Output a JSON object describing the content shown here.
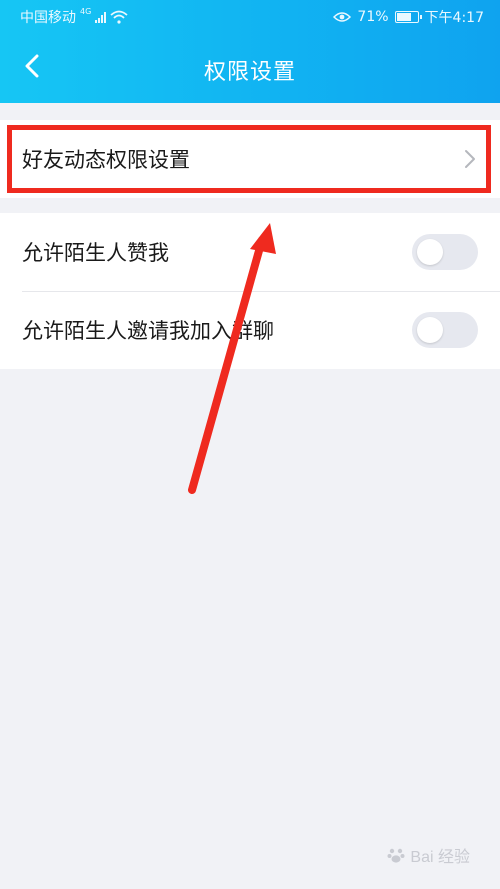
{
  "status_bar": {
    "carrier": "中国移动",
    "network_type": "4G",
    "battery_percent": "71%",
    "battery_level": 0.71,
    "time": "下午4:17"
  },
  "nav": {
    "title": "权限设置",
    "back_icon": "chevron-left-icon"
  },
  "settings": {
    "friend_feed": {
      "label": "好友动态权限设置",
      "icon": "chevron-right-icon"
    },
    "toggles": [
      {
        "label": "允许陌生人赞我",
        "enabled": false
      },
      {
        "label": "允许陌生人邀请我加入群聊",
        "enabled": false
      }
    ]
  },
  "watermark": {
    "text": "Bai 经验"
  },
  "colors": {
    "header_start": "#16c6f4",
    "header_end": "#0fa3ef",
    "highlight": "#ef2a1f",
    "background": "#f1f2f6",
    "toggle_off": "#e6e8ef"
  }
}
